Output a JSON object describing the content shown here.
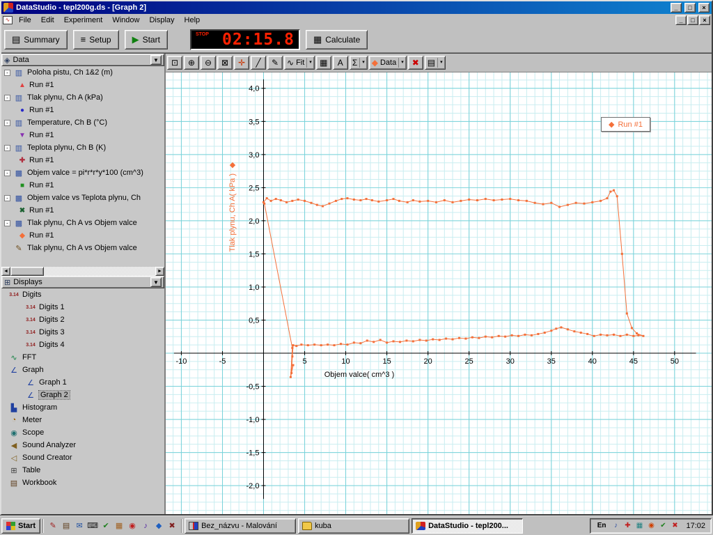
{
  "colors": {
    "series": "#f4703a",
    "accent_titlebar": "#000080",
    "lcd_red": "#ff2000"
  },
  "window": {
    "title": "DataStudio - tepl200g.ds - [Graph 2]",
    "buttons": {
      "minimize": "_",
      "restore": "□",
      "close": "×"
    }
  },
  "menu": {
    "items": [
      "File",
      "Edit",
      "Experiment",
      "Window",
      "Display",
      "Help"
    ]
  },
  "toolbar": {
    "summary_label": "Summary",
    "summary_icon": "▤",
    "setup_label": "Setup",
    "setup_icon": "≡",
    "start_label": "Start",
    "start_icon": "▶",
    "stop_label": "STOP",
    "timer_value": "02:15.8",
    "calculate_label": "Calculate",
    "calculate_icon": "▦"
  },
  "graph_toolbar": {
    "buttons": [
      {
        "name": "scale-to-fit-button",
        "icon": "⊡"
      },
      {
        "name": "zoom-in-button",
        "icon": "⊕"
      },
      {
        "name": "zoom-out-button",
        "icon": "⊖"
      },
      {
        "name": "zoom-select-button",
        "icon": "⊠"
      },
      {
        "name": "smart-tool-button",
        "icon": "✛",
        "icon_color": "#cc3300"
      },
      {
        "name": "slope-tool-button",
        "icon": "╱"
      },
      {
        "name": "note-tool-button",
        "icon": "✎"
      },
      {
        "name": "fit-menu-button",
        "icon": "∿",
        "label": "Fit",
        "dropdown": true
      },
      {
        "name": "calculator-tool-button",
        "icon": "▦"
      },
      {
        "name": "text-annotation-button",
        "icon": "A",
        "icon_color": "#000000"
      },
      {
        "name": "statistics-button",
        "icon": "Σ",
        "dropdown": true
      },
      {
        "name": "data-menu-button",
        "icon": "◆",
        "icon_color": "#f4703a",
        "label": "Data",
        "dropdown": true
      },
      {
        "name": "delete-button",
        "icon": "✖",
        "icon_color": "#cc0000"
      },
      {
        "name": "graph-settings-button",
        "icon": "▤",
        "dropdown": true
      }
    ]
  },
  "data_panel": {
    "title": "Data",
    "header_icon": "◈",
    "items": [
      {
        "label": "Poloha pistu, Ch 1&2 (m)",
        "icon_glyph": "▥",
        "icon_color": "#3050a0",
        "run": "Run #1",
        "marker": "triangle-up",
        "marker_color": "#e04040"
      },
      {
        "label": "Tlak plynu, Ch A (kPa)",
        "icon_glyph": "▥",
        "icon_color": "#3050a0",
        "run": "Run #1",
        "marker": "circle",
        "marker_color": "#2828c8"
      },
      {
        "label": "Temperature, Ch B (°C)",
        "icon_glyph": "▥",
        "icon_color": "#3050a0",
        "run": "Run #1",
        "marker": "triangle-down",
        "marker_color": "#8830b0"
      },
      {
        "label": "Teplota plynu, Ch B (K)",
        "icon_glyph": "▥",
        "icon_color": "#3050a0",
        "run": "Run #1",
        "marker": "plus",
        "marker_color": "#b03040"
      },
      {
        "label": "Objem valce = pi*r*r*y*100 (cm^3)",
        "icon_glyph": "▩",
        "icon_color": "#3050a0",
        "run": "Run #1",
        "marker": "square",
        "marker_color": "#209020"
      },
      {
        "label": "Objem valce vs Teplota plynu, Ch",
        "icon_glyph": "▩",
        "icon_color": "#3050a0",
        "run": "Run #1",
        "marker": "cross",
        "marker_color": "#1a6030"
      },
      {
        "label": "Tlak plynu, Ch A vs Objem valce",
        "icon_glyph": "▩",
        "icon_color": "#3050a0",
        "run": "Run #1",
        "marker": "diamond",
        "marker_color": "#f4703a"
      },
      {
        "label": "Tlak plynu, Ch A vs Objem valce",
        "icon_glyph": "✎",
        "icon_color": "#705020",
        "run": null,
        "marker": null
      }
    ]
  },
  "displays_panel": {
    "title": "Displays",
    "header_icon": "⊞",
    "items": [
      {
        "label": "Digits",
        "icon_glyph": "3.14",
        "icon_color": "#902020",
        "children": [
          {
            "label": "Digits 1"
          },
          {
            "label": "Digits 2"
          },
          {
            "label": "Digits 3"
          },
          {
            "label": "Digits 4"
          }
        ]
      },
      {
        "label": "FFT",
        "icon_glyph": "∿",
        "icon_color": "#108040"
      },
      {
        "label": "Graph",
        "icon_glyph": "∠",
        "icon_color": "#2040a0",
        "children": [
          {
            "label": "Graph 1"
          },
          {
            "label": "Graph 2",
            "selected": true
          }
        ]
      },
      {
        "label": "Histogram",
        "icon_glyph": "▙",
        "icon_color": "#2040a0"
      },
      {
        "label": "Meter",
        "icon_glyph": "◔",
        "icon_color": "#a06000"
      },
      {
        "label": "Scope",
        "icon_glyph": "◉",
        "icon_color": "#207070"
      },
      {
        "label": "Sound Analyzer",
        "icon_glyph": "◀",
        "icon_color": "#806020"
      },
      {
        "label": "Sound Creator",
        "icon_glyph": "◁",
        "icon_color": "#806020"
      },
      {
        "label": "Table",
        "icon_glyph": "⊞",
        "icon_color": "#404040"
      },
      {
        "label": "Workbook",
        "icon_glyph": "▤",
        "icon_color": "#604020"
      }
    ]
  },
  "chart_data": {
    "type": "scatter",
    "title": "",
    "xlabel": "Objem valce( cm^3 )",
    "ylabel": "Tlak plynu, Ch A( kPa )",
    "legend_label": "Run #1",
    "legend_marker": "◆",
    "xlim": [
      -11.9,
      54.5
    ],
    "ylim": [
      -2.43,
      4.24
    ],
    "grid": true,
    "grid_minor_color": "#c9edf0",
    "grid_major_color": "#79d2da",
    "x_ticks": [
      {
        "v": -10,
        "label": "-10"
      },
      {
        "v": -5,
        "label": "-5"
      },
      {
        "v": 5,
        "label": "5"
      },
      {
        "v": 10,
        "label": "10"
      },
      {
        "v": 15,
        "label": "15"
      },
      {
        "v": 20,
        "label": "20"
      },
      {
        "v": 25,
        "label": "25"
      },
      {
        "v": 30,
        "label": "30"
      },
      {
        "v": 35,
        "label": "35"
      },
      {
        "v": 40,
        "label": "40"
      },
      {
        "v": 45,
        "label": "45"
      },
      {
        "v": 50,
        "label": "50"
      }
    ],
    "y_ticks": [
      {
        "v": 4.0,
        "label": "4,0"
      },
      {
        "v": 3.5,
        "label": "3,5"
      },
      {
        "v": 3.0,
        "label": "3,0"
      },
      {
        "v": 2.5,
        "label": "2,5"
      },
      {
        "v": 2.0,
        "label": "2,0"
      },
      {
        "v": 1.5,
        "label": "1,5"
      },
      {
        "v": 1.0,
        "label": "1,0"
      },
      {
        "v": 0.5,
        "label": "0,5"
      },
      {
        "v": -0.5,
        "label": "-0,5"
      },
      {
        "v": -1.0,
        "label": "-1,0"
      },
      {
        "v": -1.5,
        "label": "-1,5"
      },
      {
        "v": -2.0,
        "label": "-2,0"
      }
    ],
    "series": [
      {
        "name": "Run #1",
        "color": "#f4703a",
        "points": [
          [
            0,
            2.28
          ],
          [
            0.4,
            2.34
          ],
          [
            0.9,
            2.3
          ],
          [
            1.5,
            2.33
          ],
          [
            2.1,
            2.31
          ],
          [
            2.8,
            2.28
          ],
          [
            3.5,
            2.3
          ],
          [
            4.2,
            2.32
          ],
          [
            5,
            2.3
          ],
          [
            5.8,
            2.27
          ],
          [
            6.5,
            2.24
          ],
          [
            7.2,
            2.22
          ],
          [
            8,
            2.26
          ],
          [
            8.8,
            2.3
          ],
          [
            9.5,
            2.33
          ],
          [
            10.2,
            2.34
          ],
          [
            11,
            2.32
          ],
          [
            11.8,
            2.31
          ],
          [
            12.5,
            2.33
          ],
          [
            13.2,
            2.31
          ],
          [
            14,
            2.29
          ],
          [
            15,
            2.31
          ],
          [
            15.8,
            2.33
          ],
          [
            16.5,
            2.3
          ],
          [
            17.5,
            2.28
          ],
          [
            18.2,
            2.31
          ],
          [
            19,
            2.29
          ],
          [
            20,
            2.3
          ],
          [
            21,
            2.28
          ],
          [
            22,
            2.31
          ],
          [
            23,
            2.28
          ],
          [
            24,
            2.3
          ],
          [
            25,
            2.32
          ],
          [
            26,
            2.31
          ],
          [
            27,
            2.33
          ],
          [
            28,
            2.31
          ],
          [
            29,
            2.32
          ],
          [
            30,
            2.33
          ],
          [
            31,
            2.31
          ],
          [
            32,
            2.3
          ],
          [
            33,
            2.27
          ],
          [
            34,
            2.25
          ],
          [
            35,
            2.27
          ],
          [
            36,
            2.21
          ],
          [
            37,
            2.24
          ],
          [
            38,
            2.27
          ],
          [
            39,
            2.26
          ],
          [
            40,
            2.28
          ],
          [
            41,
            2.3
          ],
          [
            41.8,
            2.34
          ],
          [
            42.2,
            2.44
          ],
          [
            42.6,
            2.46
          ],
          [
            43,
            2.37
          ],
          [
            43.6,
            1.5
          ],
          [
            44.2,
            0.6
          ],
          [
            44.8,
            0.38
          ],
          [
            45.4,
            0.3
          ],
          [
            46.2,
            0.26
          ],
          [
            45.6,
            0.27
          ],
          [
            45,
            0.26
          ],
          [
            44.2,
            0.28
          ],
          [
            43.4,
            0.26
          ],
          [
            42.6,
            0.28
          ],
          [
            41.8,
            0.27
          ],
          [
            41,
            0.28
          ],
          [
            40.2,
            0.26
          ],
          [
            39.4,
            0.29
          ],
          [
            38.6,
            0.31
          ],
          [
            37.8,
            0.33
          ],
          [
            37,
            0.36
          ],
          [
            36.2,
            0.39
          ],
          [
            35.6,
            0.37
          ],
          [
            35,
            0.34
          ],
          [
            34.2,
            0.31
          ],
          [
            33.4,
            0.29
          ],
          [
            32.6,
            0.27
          ],
          [
            31.8,
            0.28
          ],
          [
            31,
            0.26
          ],
          [
            30.2,
            0.27
          ],
          [
            29.4,
            0.25
          ],
          [
            28.6,
            0.26
          ],
          [
            27.8,
            0.24
          ],
          [
            27,
            0.25
          ],
          [
            26.2,
            0.23
          ],
          [
            25.4,
            0.24
          ],
          [
            24.6,
            0.22
          ],
          [
            23.8,
            0.23
          ],
          [
            23,
            0.21
          ],
          [
            22.2,
            0.22
          ],
          [
            21.4,
            0.2
          ],
          [
            20.6,
            0.21
          ],
          [
            19.8,
            0.19
          ],
          [
            19,
            0.2
          ],
          [
            18.2,
            0.18
          ],
          [
            17.4,
            0.19
          ],
          [
            16.6,
            0.17
          ],
          [
            15.8,
            0.18
          ],
          [
            15,
            0.16
          ],
          [
            14.2,
            0.2
          ],
          [
            13.4,
            0.17
          ],
          [
            12.6,
            0.19
          ],
          [
            11.8,
            0.15
          ],
          [
            11,
            0.16
          ],
          [
            10.2,
            0.13
          ],
          [
            9.4,
            0.14
          ],
          [
            8.6,
            0.12
          ],
          [
            7.8,
            0.13
          ],
          [
            7,
            0.12
          ],
          [
            6.2,
            0.13
          ],
          [
            5.4,
            0.12
          ],
          [
            4.6,
            0.13
          ],
          [
            4,
            0.11
          ],
          [
            3.6,
            0.12
          ],
          [
            3.5,
            -0.05
          ],
          [
            3.4,
            -0.3
          ],
          [
            3.6,
            -0.18
          ],
          [
            3.3,
            -0.36
          ],
          [
            3.5,
            0.08
          ],
          [
            0.1,
            2.26
          ]
        ]
      }
    ]
  },
  "taskbar": {
    "start_label": "Start",
    "quick_launch": [
      {
        "glyph": "✎",
        "color": "#a02020"
      },
      {
        "glyph": "▤",
        "color": "#604020"
      },
      {
        "glyph": "✉",
        "color": "#2050a0"
      },
      {
        "glyph": "⌨",
        "color": "#202020"
      },
      {
        "glyph": "✔",
        "color": "#208020"
      },
      {
        "glyph": "▦",
        "color": "#a06020"
      },
      {
        "glyph": "◉",
        "color": "#c02020"
      },
      {
        "glyph": "♪",
        "color": "#5020a0"
      },
      {
        "glyph": "◆",
        "color": "#2060c0"
      },
      {
        "glyph": "✖",
        "color": "#802020"
      }
    ],
    "tasks": [
      {
        "label": "Bez_názvu - Malování",
        "icon": "paint",
        "active": false
      },
      {
        "label": "kuba",
        "icon": "folder",
        "active": false
      },
      {
        "label": "DataStudio - tepl200...",
        "icon": "datastudio",
        "active": true
      }
    ],
    "tray_lang": "En",
    "tray_icons": [
      {
        "glyph": "♪",
        "color": "#3050a0"
      },
      {
        "glyph": "✚",
        "color": "#c02020"
      },
      {
        "glyph": "▦",
        "color": "#208080"
      },
      {
        "glyph": "◉",
        "color": "#d04000"
      },
      {
        "glyph": "✔",
        "color": "#208020"
      },
      {
        "glyph": "✖",
        "color": "#c02020"
      }
    ],
    "clock": "17:02"
  }
}
